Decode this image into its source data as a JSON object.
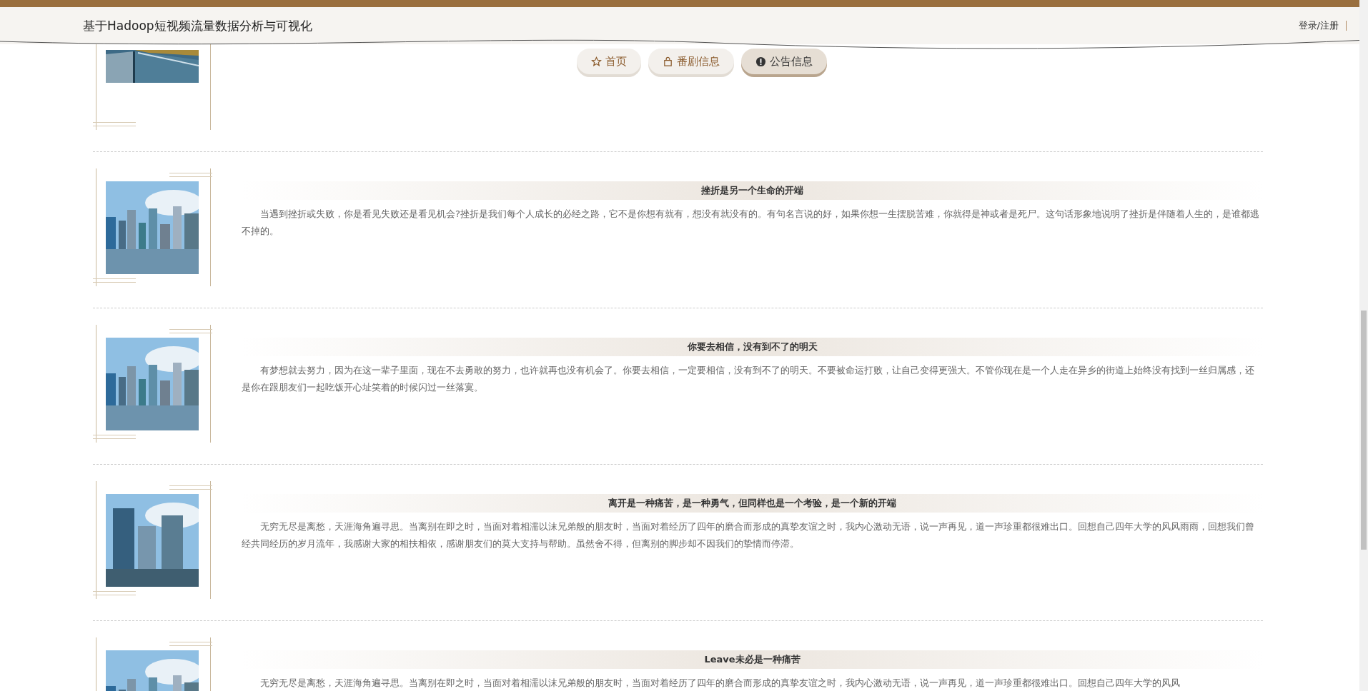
{
  "header": {
    "title": "基于Hadoop短视频流量数据分析与可视化",
    "login": "登录/注册"
  },
  "nav": [
    {
      "label": "首页",
      "selected": false
    },
    {
      "label": "番剧信息",
      "selected": false
    },
    {
      "label": "公告信息",
      "selected": true
    }
  ],
  "notices": [
    {
      "title": "挫折是另一个生命的开端",
      "body": "当遇到挫折或失败，你是看见失败还是看见机会?挫折是我们每个人成长的必经之路，它不是你想有就有，想没有就没有的。有句名言说的好，如果你想一生摆脱苦难，你就得是神或者是死尸。这句话形象地说明了挫折是伴随着人生的，是谁都逃不掉的。"
    },
    {
      "title": "你要去相信，没有到不了的明天",
      "body": "有梦想就去努力，因为在这一辈子里面，现在不去勇敢的努力，也许就再也没有机会了。你要去相信，一定要相信，没有到不了的明天。不要被命运打败，让自己变得更强大。不管你现在是一个人走在异乡的街道上始终没有找到一丝归属感，还是你在跟朋友们一起吃饭开心址笑着的时候闪过一丝落寞。"
    },
    {
      "title": "离开是一种痛苦，是一种勇气，但同样也是一个考验，是一个新的开端",
      "body": "无穷无尽是离愁，天涯海角遍寻思。当离别在即之时，当面对着相濡以沫兄弟般的朋友时，当面对着经历了四年的磨合而形成的真挚友谊之时，我内心激动无语，说一声再见，道一声珍重都很难出口。回想自己四年大学的风风雨雨，回想我们曾经共同经历的岁月流年，我感谢大家的相扶相依，感谢朋友们的莫大支持与帮助。虽然舍不得，但离别的脚步却不因我们的挚情而停滞。"
    },
    {
      "title": "Leave未必是一种痛苦",
      "body": "无穷无尽是离愁，天涯海角遍寻思。当离别在即之时，当面对着相濡以沫兄弟般的朋友时，当面对着经历了四年的磨合而形成的真挚友谊之时，我内心激动无语，说一声再见，道一声珍重都很难出口。回想自己四年大学的风风"
    }
  ]
}
